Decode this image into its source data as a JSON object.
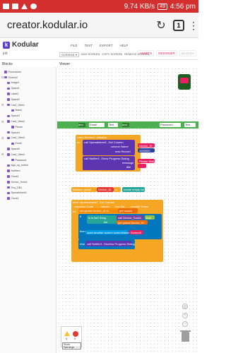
{
  "status": {
    "speed": "9.74 KB/s",
    "battery": "49",
    "time": "4:56 pm"
  },
  "browser": {
    "url": "creator.kodular.io",
    "tab_count": "1"
  },
  "kodular": {
    "logo_text": "Kodular",
    "project": "job",
    "menu": [
      "FILE",
      "TEST",
      "EXPORT",
      "HELP"
    ],
    "screen_select": "SCREEN1 ▾",
    "tools": [
      "ADD SCREEN",
      "COPY SCREEN",
      "REMOVE SCREEN"
    ],
    "modes": [
      "ASSETS",
      "DESIGNER",
      "BLOCKS"
    ]
  },
  "panels": {
    "blocks_title": "Blocks",
    "viewer_title": "Viewer"
  },
  "tree": [
    {
      "label": "Procedures",
      "level": 0
    },
    {
      "label": "Screen2",
      "level": 0,
      "toggle": "⊟"
    },
    {
      "label": "Image1",
      "level": 1
    },
    {
      "label": "Space1",
      "level": 1
    },
    {
      "label": "Label1",
      "level": 1
    },
    {
      "label": "Space2",
      "level": 1
    },
    {
      "label": "Card_View1",
      "level": 1,
      "toggle": "⊟"
    },
    {
      "label": "Name",
      "level": 2
    },
    {
      "label": "Space3",
      "level": 1
    },
    {
      "label": "Card_View2",
      "level": 1,
      "toggle": "⊟"
    },
    {
      "label": "Phone",
      "level": 2
    },
    {
      "label": "Space4",
      "level": 1
    },
    {
      "label": "Card_View3",
      "level": 1,
      "toggle": "⊟"
    },
    {
      "label": "Email",
      "level": 2
    },
    {
      "label": "Space5",
      "level": 1
    },
    {
      "label": "Card_View4",
      "level": 1,
      "toggle": "⊟"
    },
    {
      "label": "Password",
      "level": 2
    },
    {
      "label": "sign_up_button",
      "level": 1
    },
    {
      "label": "Notifier1",
      "level": 1
    },
    {
      "label": "Clock1",
      "level": 1
    },
    {
      "label": "Device_Tools1",
      "level": 1
    },
    {
      "label": "Tiny_DB1",
      "level": 1
    },
    {
      "label": "Spreadsheet1",
      "level": 1
    },
    {
      "label": "Clock1",
      "level": 1
    }
  ],
  "workspace": {
    "bar_chips": [
      "and",
      "Email",
      "Text",
      "and",
      "Password",
      "Text"
    ],
    "event1": {
      "header": "when Screen2 .Initialize",
      "do": "do",
      "call_sheet": "call Spreadsheet1 .Get Column",
      "column_name": "column Name",
      "column_value": "Device_ID",
      "max_record": "max Record",
      "max_value": "1000000",
      "call_notifier": "call Notifier1 .Show Progress Dialog",
      "message": "message",
      "message_value": "Please Wait",
      "title": "title"
    },
    "global": {
      "initialize": "initialize global",
      "name": "Device_ID",
      "to": "to",
      "empty_list": "create empty list"
    },
    "event2": {
      "header": "when Spreadsheet1 .Got Column",
      "params": [
        "response Code",
        "values",
        "row IDs",
        "created Times"
      ],
      "do": "do",
      "set_global": "set global Device_ID to",
      "get_values": "get values",
      "if": "if",
      "is_in_list": "is in list? thing",
      "call_device": "call Device_Tools1 .",
      "device_id": "Device_ID",
      "list": "list",
      "get_global": "get global Device_ID",
      "true": "true",
      "then": "then",
      "open_screen": "open another screen  screenName",
      "screen_name": "Screen3",
      "else": "else",
      "dismiss": "call Notifier1 .Dismiss Progress Dialog"
    },
    "warnings": {
      "warn_count": "0",
      "error_count": "0",
      "show_label": "Show Warnings"
    }
  }
}
